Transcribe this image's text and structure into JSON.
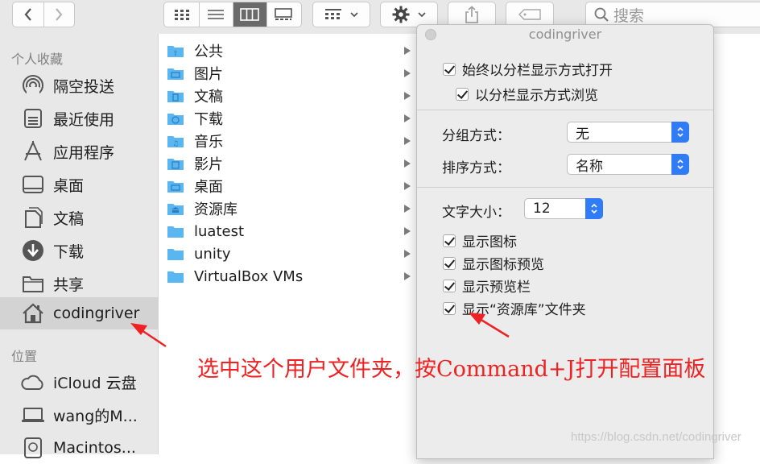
{
  "toolbar": {
    "back_icon": "chevron-left-icon",
    "forward_icon": "chevron-right-icon",
    "view_modes": [
      "icon-view",
      "list-view",
      "column-view",
      "gallery-view"
    ],
    "active_view": "column-view",
    "search_placeholder": "搜索"
  },
  "sidebar": {
    "favorites_header": "个人收藏",
    "favorites": [
      {
        "label": "隔空投送",
        "icon": "airdrop-icon"
      },
      {
        "label": "最近使用",
        "icon": "recents-icon"
      },
      {
        "label": "应用程序",
        "icon": "applications-icon"
      },
      {
        "label": "桌面",
        "icon": "desktop-icon"
      },
      {
        "label": "文稿",
        "icon": "documents-icon"
      },
      {
        "label": "下载",
        "icon": "downloads-icon"
      },
      {
        "label": "共享",
        "icon": "shared-folder-icon"
      },
      {
        "label": "codingriver",
        "icon": "home-icon",
        "selected": true
      }
    ],
    "locations_header": "位置",
    "locations": [
      {
        "label": "iCloud 云盘",
        "icon": "icloud-icon"
      },
      {
        "label": "wang的M...",
        "icon": "laptop-icon"
      },
      {
        "label": "Macintos...",
        "icon": "disk-icon"
      }
    ]
  },
  "column": {
    "items": [
      {
        "label": "公共",
        "glyph": "⇪"
      },
      {
        "label": "图片",
        "glyph": "▣"
      },
      {
        "label": "文稿",
        "glyph": "▤"
      },
      {
        "label": "下载",
        "glyph": "⬇"
      },
      {
        "label": "音乐",
        "glyph": "♫"
      },
      {
        "label": "影片",
        "glyph": "▦"
      },
      {
        "label": "桌面",
        "glyph": "▭"
      },
      {
        "label": "资源库",
        "glyph": "⌂"
      },
      {
        "label": "luatest",
        "glyph": ""
      },
      {
        "label": "unity",
        "glyph": ""
      },
      {
        "label": "VirtualBox VMs",
        "glyph": ""
      }
    ]
  },
  "panel": {
    "title": "codingriver",
    "always_open_column": "始终以分栏显示方式打开",
    "browse_column": "以分栏显示方式浏览",
    "group_by_label": "分组方式：",
    "group_by_value": "无",
    "sort_by_label": "排序方式：",
    "sort_by_value": "名称",
    "text_size_label": "文字大小：",
    "text_size_value": "12",
    "show_icons": "显示图标",
    "show_icon_preview": "显示图标预览",
    "show_preview_column": "显示预览栏",
    "show_library_folder": "显示“资源库”文件夹"
  },
  "annotation": {
    "text": "选中这个用户文件夹，按Command+J打开配置面板",
    "color": "#ee2222"
  },
  "watermark": "https://blog.csdn.net/codingriver",
  "colors": {
    "accent": "#2f7cf6",
    "folder": "#5ab6f0",
    "sidebar_bg": "#e9e8e9",
    "selected_bg": "#d4d3d4"
  }
}
